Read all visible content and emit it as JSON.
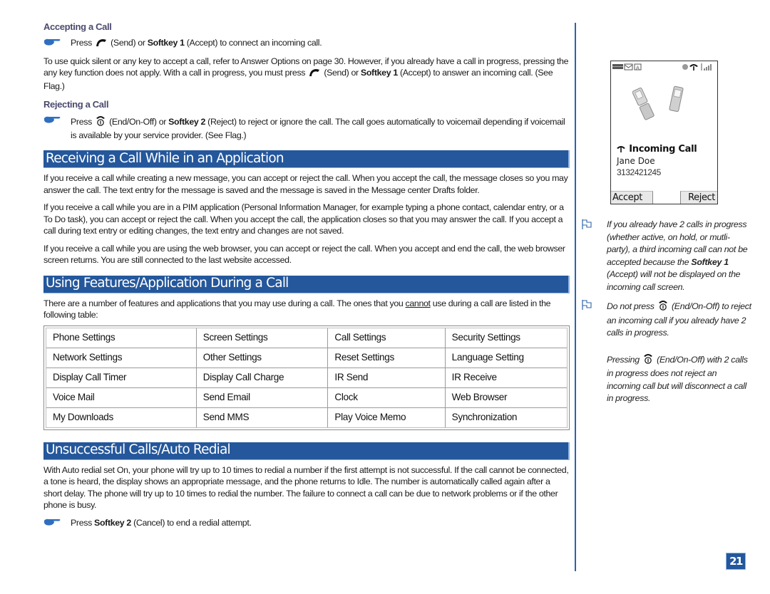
{
  "accepting": {
    "heading": "Accepting a Call",
    "bullet": {
      "press": "Press",
      "send_label": "(Send) or",
      "softkey": "Softkey 1",
      "rest": "(Accept) to connect an incoming call."
    },
    "para": {
      "part1": "To use quick silent or any key to accept a call, refer to Answer Options on page 30. However, if you already have  a call in progress, pressing the any key function does not apply. With a call in progress, you must press",
      "send_label": "(Send) or",
      "softkey": "Softkey 1",
      "part2": "(Accept) to answer an incoming call. (See Flag.)"
    }
  },
  "rejecting": {
    "heading": "Rejecting a Call",
    "bullet": {
      "press": "Press",
      "end_label": "(End/On-Off) or",
      "softkey": "Softkey 2",
      "rest": "(Reject) to reject or ignore the call. The call goes automatically to voicemail depending if voicemail is available by your service provider. (See Flag.)"
    }
  },
  "receiving": {
    "title": "Receiving a Call While in an Application",
    "paragraphs": [
      "If you receive a call while creating a new message, you can accept or reject the call. When you accept the call, the message closes so you may answer the call. The text entry for the message is saved and the message is saved in the Message center Drafts folder.",
      "If you receive a call while you are in a PIM application (Personal Information Manager, for example typing a phone contact, calendar entry, or a To Do task), you can accept or reject the call. When you accept the call, the application closes so that you may answer the call. If you accept a call during text entry or editing changes, the text entry and changes are not saved.",
      "If you receive a call while you are using the web browser, you can accept or reject the call. When you accept and end the call, the web browser screen returns. You are still connected to the last website accessed."
    ]
  },
  "features": {
    "title": "Using Features/Application During a Call",
    "intro_part1": "There are a number of features and applications that you may use during a call. The ones that you",
    "intro_underlined": "cannot",
    "intro_part2": "use during a call are listed in the following table:",
    "table": [
      [
        "Phone Settings",
        "Screen Settings",
        "Call Settings",
        "Security Settings"
      ],
      [
        "Network Settings",
        "Other Settings",
        "Reset Settings",
        "Language Setting"
      ],
      [
        "Display Call Timer",
        "Display Call Charge",
        "IR Send",
        "IR Receive"
      ],
      [
        "Voice Mail",
        "Send Email",
        "Clock",
        "Web Browser"
      ],
      [
        "My Downloads",
        "Send MMS",
        "Play Voice Memo",
        "Synchronization"
      ]
    ]
  },
  "redial": {
    "title": "Unsuccessful Calls/Auto Redial",
    "paragraph": "With Auto redial set On, your phone will try up to 10 times to redial a number if the first attempt is not successful. If the call cannot be connected, a tone is heard, the display shows an appropriate message, and the phone returns to Idle. The number is automatically called again after a short delay. The phone will try up to 10 times to redial the number. The failure to connect a call can be due to network problems or if the other phone is busy.",
    "bullet": {
      "press": "Press",
      "softkey": "Softkey 2",
      "rest": "(Cancel) to end a redial attempt."
    }
  },
  "phone_screen": {
    "title": "Incoming Call",
    "caller_name": "Jane Doe",
    "caller_number": "3132421245",
    "softkey_left": "Accept",
    "softkey_right": "Reject"
  },
  "notes": [
    {
      "part1": "If you already have 2 calls in progress (whether active, on hold, or mutli-party), a third incoming call can not be accepted because the",
      "bold": "Softkey 1",
      "part2": "(Accept) will not be displayed on the  incoming call screen."
    },
    {
      "part1": "Do not press",
      "part2": "(End/On-Off) to reject an incoming call if you already have 2 calls in progress."
    },
    {
      "part1": "Pressing",
      "part2": "(End/On-Off) with 2 calls in progress does not reject an incoming call but will disconnect a call in progress."
    }
  ],
  "page_number": "21",
  "colors": {
    "section_bar": "#24579b",
    "subheading": "#4a4a6e",
    "accent_line": "#2b63aa",
    "hand_icon": "#2f6fc0"
  }
}
